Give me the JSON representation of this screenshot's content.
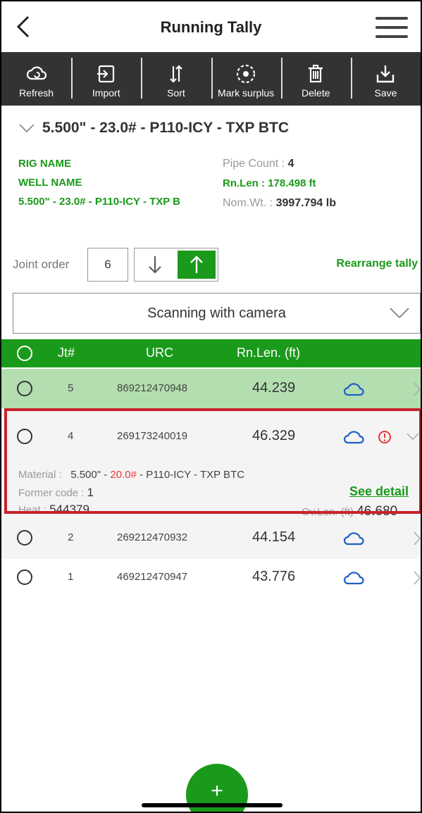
{
  "header": {
    "title": "Running Tally"
  },
  "toolbar": [
    {
      "label": "Refresh",
      "icon": "refresh-cloud-icon"
    },
    {
      "label": "Import",
      "icon": "import-icon"
    },
    {
      "label": "Sort",
      "icon": "sort-icon"
    },
    {
      "label": "Mark surplus",
      "icon": "mark-surplus-icon"
    },
    {
      "label": "Delete",
      "icon": "trash-icon"
    },
    {
      "label": "Save",
      "icon": "save-icon"
    }
  ],
  "pipe": {
    "title": "5.500\" - 23.0# - P110-ICY - TXP BTC",
    "rig_name": "RIG NAME",
    "well_name": "WELL NAME",
    "material_short": "5.500\" - 23.0# - P110-ICY - TXP B",
    "pipe_count_label": "Pipe Count :",
    "pipe_count": "4",
    "rn_len": "Rn.Len : 178.498 ft",
    "nom_wt_label": "Nom.Wt. :",
    "nom_wt": "3997.794 lb"
  },
  "joint": {
    "label": "Joint order",
    "value": "6",
    "rearrange": "Rearrange tally"
  },
  "scan": {
    "label": "Scanning with camera"
  },
  "table": {
    "headers": {
      "jt": "Jt#",
      "urc": "URC",
      "len": "Rn.Len. (ft)"
    },
    "rows": [
      {
        "jt": "5",
        "urc": "869212470948",
        "len": "44.239"
      },
      {
        "jt": "4",
        "urc": "269173240019",
        "len": "46.329"
      },
      {
        "jt": "2",
        "urc": "269212470932",
        "len": "44.154"
      },
      {
        "jt": "1",
        "urc": "469212470947",
        "len": "43.776"
      }
    ]
  },
  "detail": {
    "material_label": "Material :",
    "material_pre": "5.500\" - ",
    "material_weight": "20.0#",
    "material_post": " - P110-ICY - TXP BTC",
    "former_label": "Former code :",
    "former_value": "1",
    "heat_label": "Heat :",
    "heat_value": "544379",
    "see_detail": "See detail",
    "ov_label": "Ov.Len. (ft)",
    "ov_value": "46.680"
  },
  "fab": {
    "label": "+"
  },
  "colors": {
    "accent": "#1a9a1a",
    "toolbar": "#333333",
    "highlight": "#c8232c",
    "cloud": "#1e5fc4"
  }
}
